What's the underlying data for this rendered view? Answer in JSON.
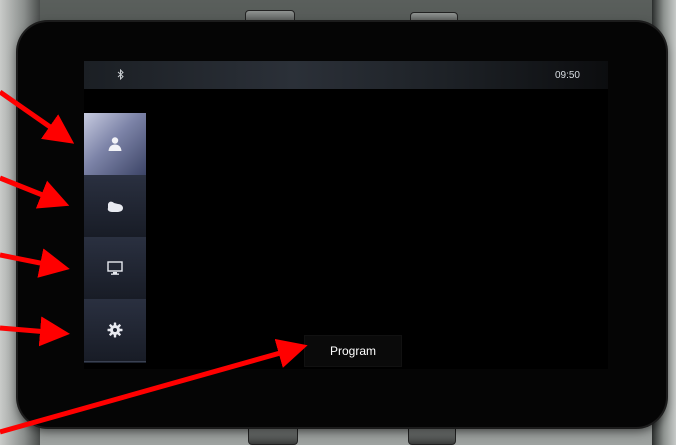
{
  "statusbar": {
    "bluetooth_icon": "bluetooth-icon",
    "time": "09:50"
  },
  "sidebar": {
    "items": [
      {
        "icon": "user-icon",
        "active": true
      },
      {
        "icon": "hand-icon",
        "active": false
      },
      {
        "icon": "monitor-icon",
        "active": false
      },
      {
        "icon": "gear-icon",
        "active": false
      }
    ]
  },
  "main": {
    "program_label": "Program"
  },
  "annotations": {
    "arrow_color": "#ff0000"
  }
}
